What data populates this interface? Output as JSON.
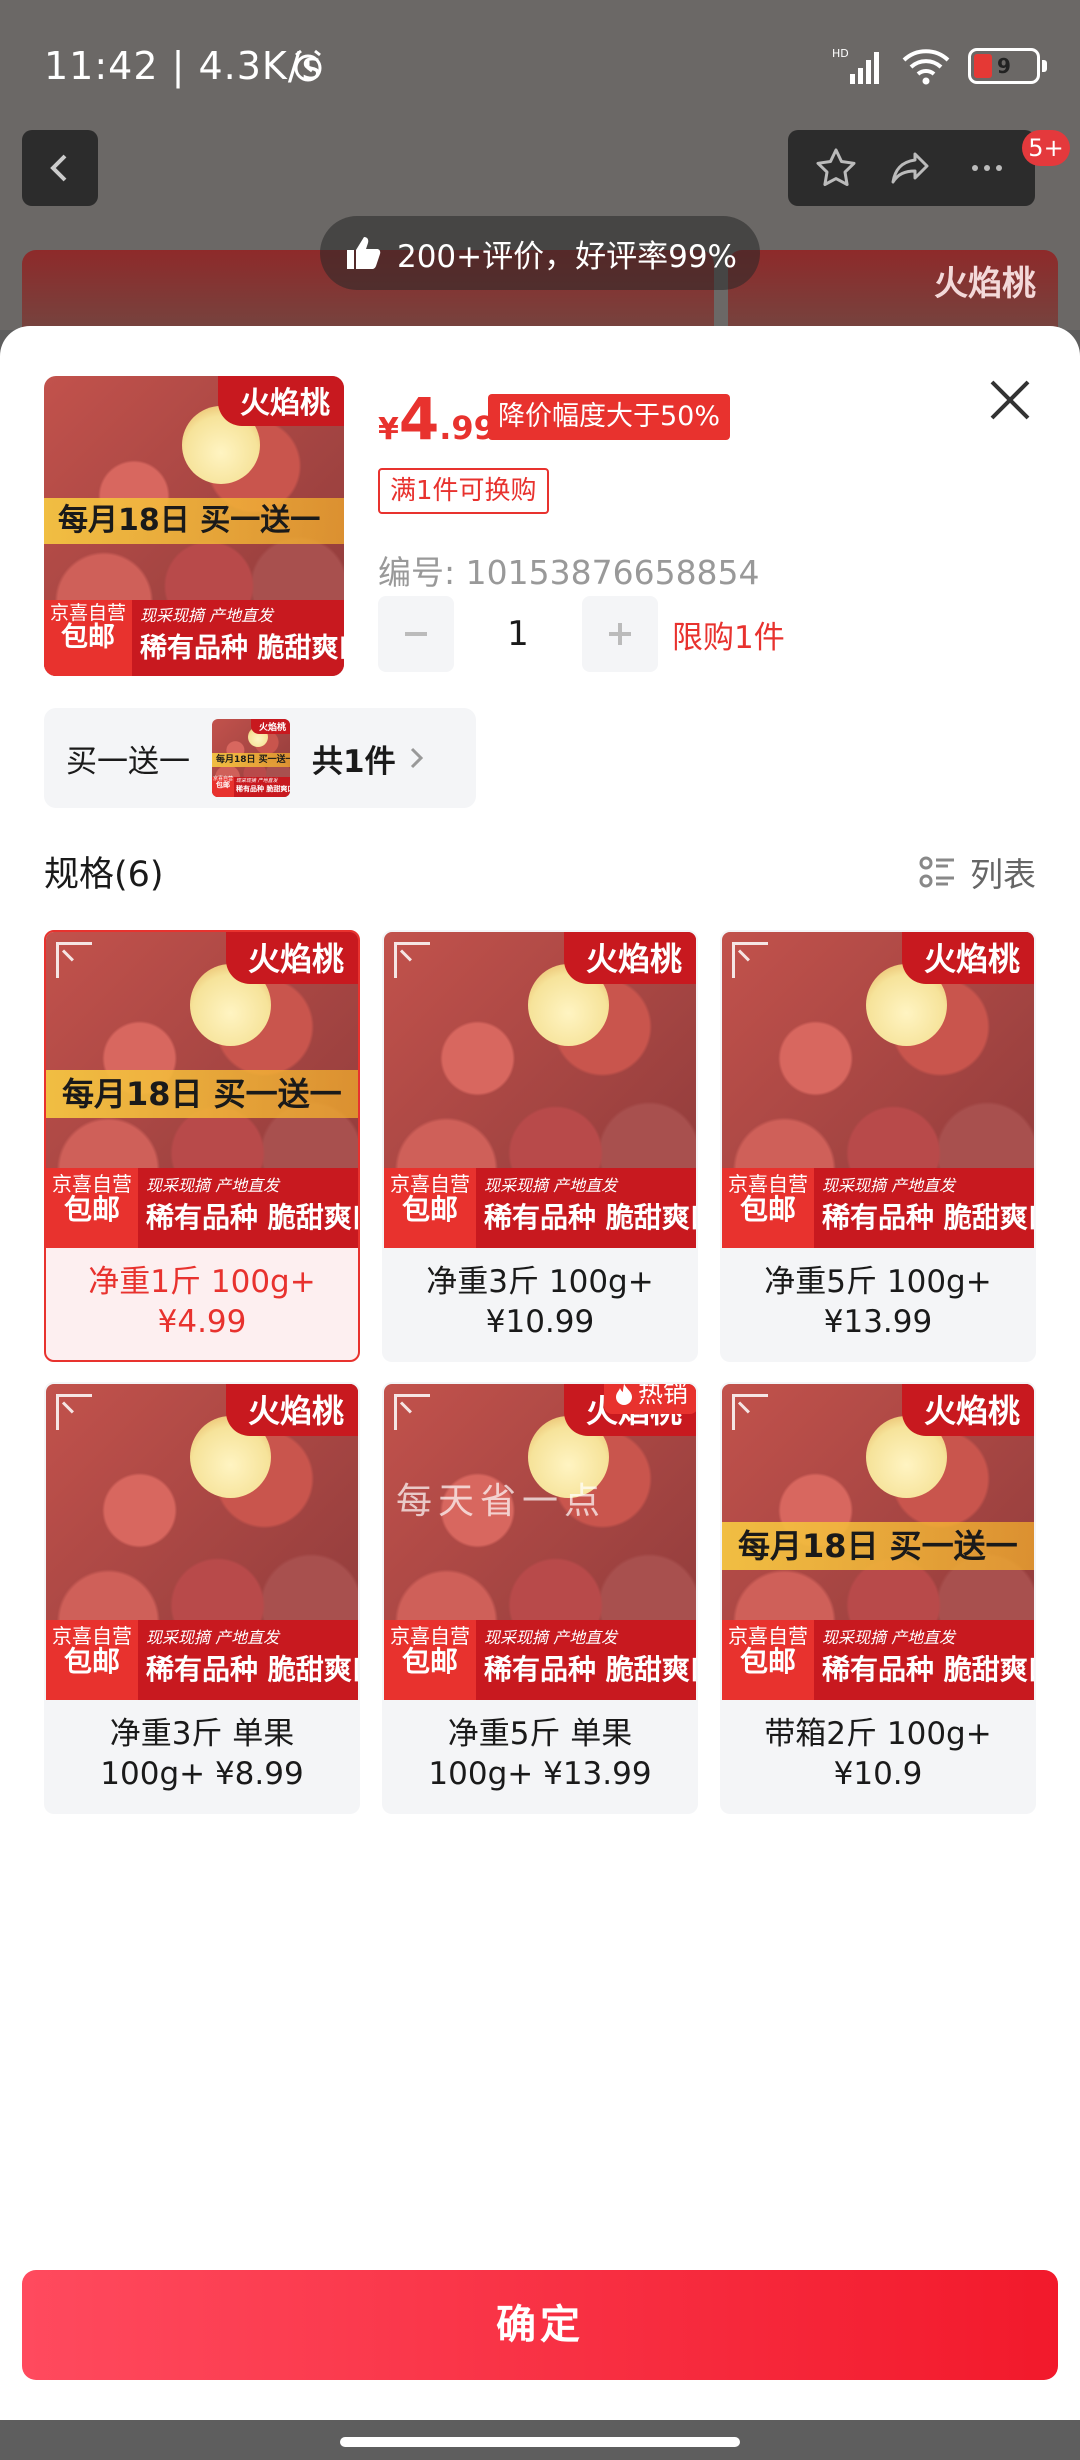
{
  "status_bar": {
    "time": "11:42 | 4.3K/s",
    "battery": "9",
    "network": "HD"
  },
  "nav": {
    "badge": "5+"
  },
  "background": {
    "review_text": "200+评价，好评率99%",
    "hero_side_ribbon": "火焰桃"
  },
  "product": {
    "price_symbol": "¥",
    "price_int": "4",
    "price_dec": ".99",
    "discount_tag": "降价幅度大于50%",
    "swap_tag": "满1件可换购",
    "sku_code": "编号: 10153876658854",
    "quantity": "1",
    "limit": "限购1件"
  },
  "image_text": {
    "ribbon": "火焰桃",
    "promo": "每月18日 买一送一",
    "foot_left_small": "京喜自营",
    "foot_left": "包邮",
    "foot_right_small": "现采现摘  产地直发",
    "foot_right": "稀有品种 脆甜爽口"
  },
  "bundle": {
    "label": "买一送一",
    "count": "共1件"
  },
  "specs": {
    "title": "规格(6)",
    "view_label": "列表",
    "hot_label": "热销",
    "items": [
      {
        "line1": "净重1斤 100g+",
        "line2": "¥4.99",
        "selected": true,
        "promo": true,
        "hot": false
      },
      {
        "line1": "净重3斤 100g+",
        "line2": "¥10.99",
        "selected": false,
        "promo": false,
        "hot": false
      },
      {
        "line1": "净重5斤 100g+",
        "line2": "¥13.99",
        "selected": false,
        "promo": false,
        "hot": false
      },
      {
        "line1": "净重3斤 单果",
        "line2": "100g+ ¥8.99",
        "selected": false,
        "promo": false,
        "hot": false
      },
      {
        "line1": "净重5斤 单果",
        "line2": "100g+ ¥13.99",
        "selected": false,
        "promo": false,
        "hot": true
      },
      {
        "line1": "带箱2斤 100g+",
        "line2": "¥10.9",
        "selected": false,
        "promo": true,
        "hot": false
      }
    ]
  },
  "watermark": "每天省一点",
  "confirm_label": "确定",
  "colors": {
    "accent": "#e8322e",
    "confirm_gradient_start": "#ff4a5e",
    "confirm_gradient_end": "#f2192b",
    "promo_band": "#f4c442"
  },
  "icons": [
    "alarm-icon",
    "signal-icon",
    "wifi-icon",
    "battery-icon",
    "back-icon",
    "star-icon",
    "share-icon",
    "more-icon",
    "thumbs-up-icon",
    "close-icon",
    "minus-icon",
    "plus-icon",
    "chevron-right-icon",
    "list-view-icon",
    "flame-icon",
    "expand-icon"
  ]
}
